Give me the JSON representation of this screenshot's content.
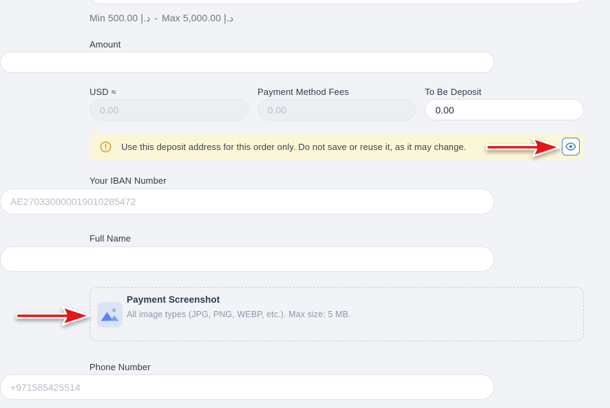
{
  "limits": {
    "min": "Min 500.00",
    "currency": "د.إ",
    "separator": "-",
    "max": "Max 5,000.00"
  },
  "fields": {
    "amount": {
      "label": "Amount",
      "value": ""
    },
    "usd": {
      "label": "USD ≈",
      "placeholder": "0.00",
      "state": "disabled"
    },
    "fees": {
      "label": "Payment Method Fees",
      "placeholder": "0.00",
      "state": "disabled"
    },
    "to_be_deposit": {
      "label": "To Be Deposit",
      "value": "0.00"
    },
    "iban": {
      "label": "Your IBAN Number",
      "placeholder": "AE270330000019010285472"
    },
    "full_name": {
      "label": "Full Name",
      "value": ""
    },
    "phone": {
      "label": "Phone Number",
      "placeholder": "+971585425514"
    }
  },
  "notice": {
    "text": "Use this deposit address for this order only. Do not save or reuse it, as it may change.",
    "icon": "warning-circle-icon",
    "action_icon": "eye-icon"
  },
  "upload": {
    "title": "Payment Screenshot",
    "subtitle": "All image types (JPG, PNG, WEBP, etc.). Max size: 5 MB.",
    "icon": "image-icon"
  },
  "annotations": {
    "arrow_1_points_to": "eye-button",
    "arrow_2_points_to": "payment-screenshot-upload"
  },
  "colors": {
    "page_bg": "#f1f3f6",
    "accent_blue": "#3b7df0",
    "banner_bg": "#fbf6d8",
    "warning_icon": "#dd9f35",
    "annotation_arrow_red": "#e31616",
    "upload_title": "#2b3a55"
  }
}
